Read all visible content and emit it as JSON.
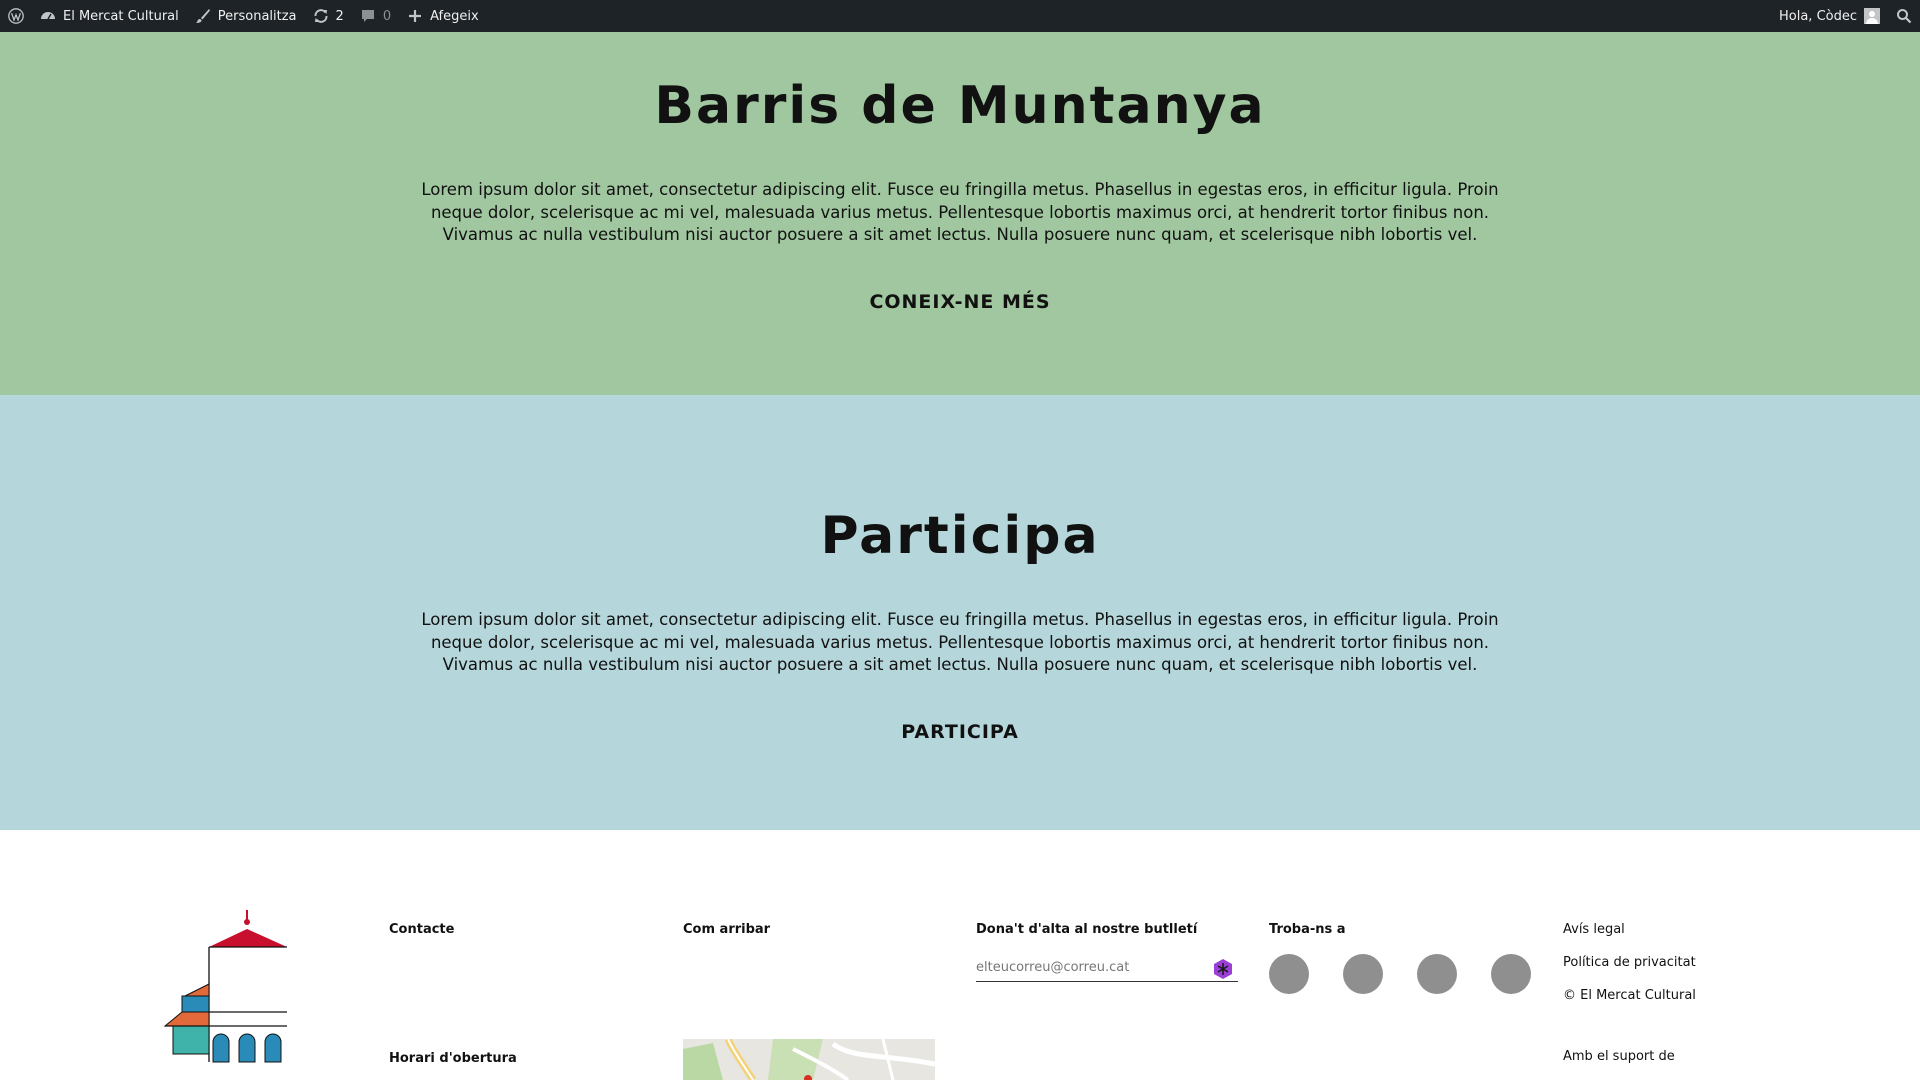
{
  "adminbar": {
    "site_name": "El Mercat Cultural",
    "customize": "Personalitza",
    "updates_count": "2",
    "comments_count": "0",
    "new_label": "Afegeix",
    "greeting": "Hola, Còdec"
  },
  "section_barris": {
    "title": "Barris de Muntanya",
    "body": "Lorem ipsum dolor sit amet, consectetur adipiscing elit. Fusce eu fringilla metus. Phasellus in egestas eros, in efficitur ligula. Proin neque dolor, scelerisque ac mi vel, malesuada varius metus. Pellentesque lobortis maximus orci, at hendrerit tortor finibus non. Vivamus ac nulla vestibulum nisi auctor posuere a sit amet lectus. Nulla posuere nunc quam, et scelerisque nibh lobortis vel.",
    "cta": "CONEIX-NE MÉS",
    "bg_color": "#a0c79f"
  },
  "section_participa": {
    "title": "Participa",
    "body": "Lorem ipsum dolor sit amet, consectetur adipiscing elit. Fusce eu fringilla metus. Phasellus in egestas eros, in efficitur ligula. Proin neque dolor, scelerisque ac mi vel, malesuada varius metus. Pellentesque lobortis maximus orci, at hendrerit tortor finibus non. Vivamus ac nulla vestibulum nisi auctor posuere a sit amet lectus. Nulla posuere nunc quam, et scelerisque nibh lobortis vel.",
    "cta": "PARTICIPA",
    "bg_color": "#b5d6da"
  },
  "footer": {
    "contact_heading": "Contacte",
    "hours_heading": "Horari d'obertura",
    "directions_heading": "Com arribar",
    "newsletter_heading": "Dona't d'alta al nostre butlletí",
    "newsletter_placeholder": "elteucorreu@correu.cat",
    "social_heading": "Troba-ns a",
    "links": [
      "Avís legal",
      "Política de privacitat",
      "© El Mercat Cultural"
    ],
    "support_label": "Amb el suport de"
  }
}
